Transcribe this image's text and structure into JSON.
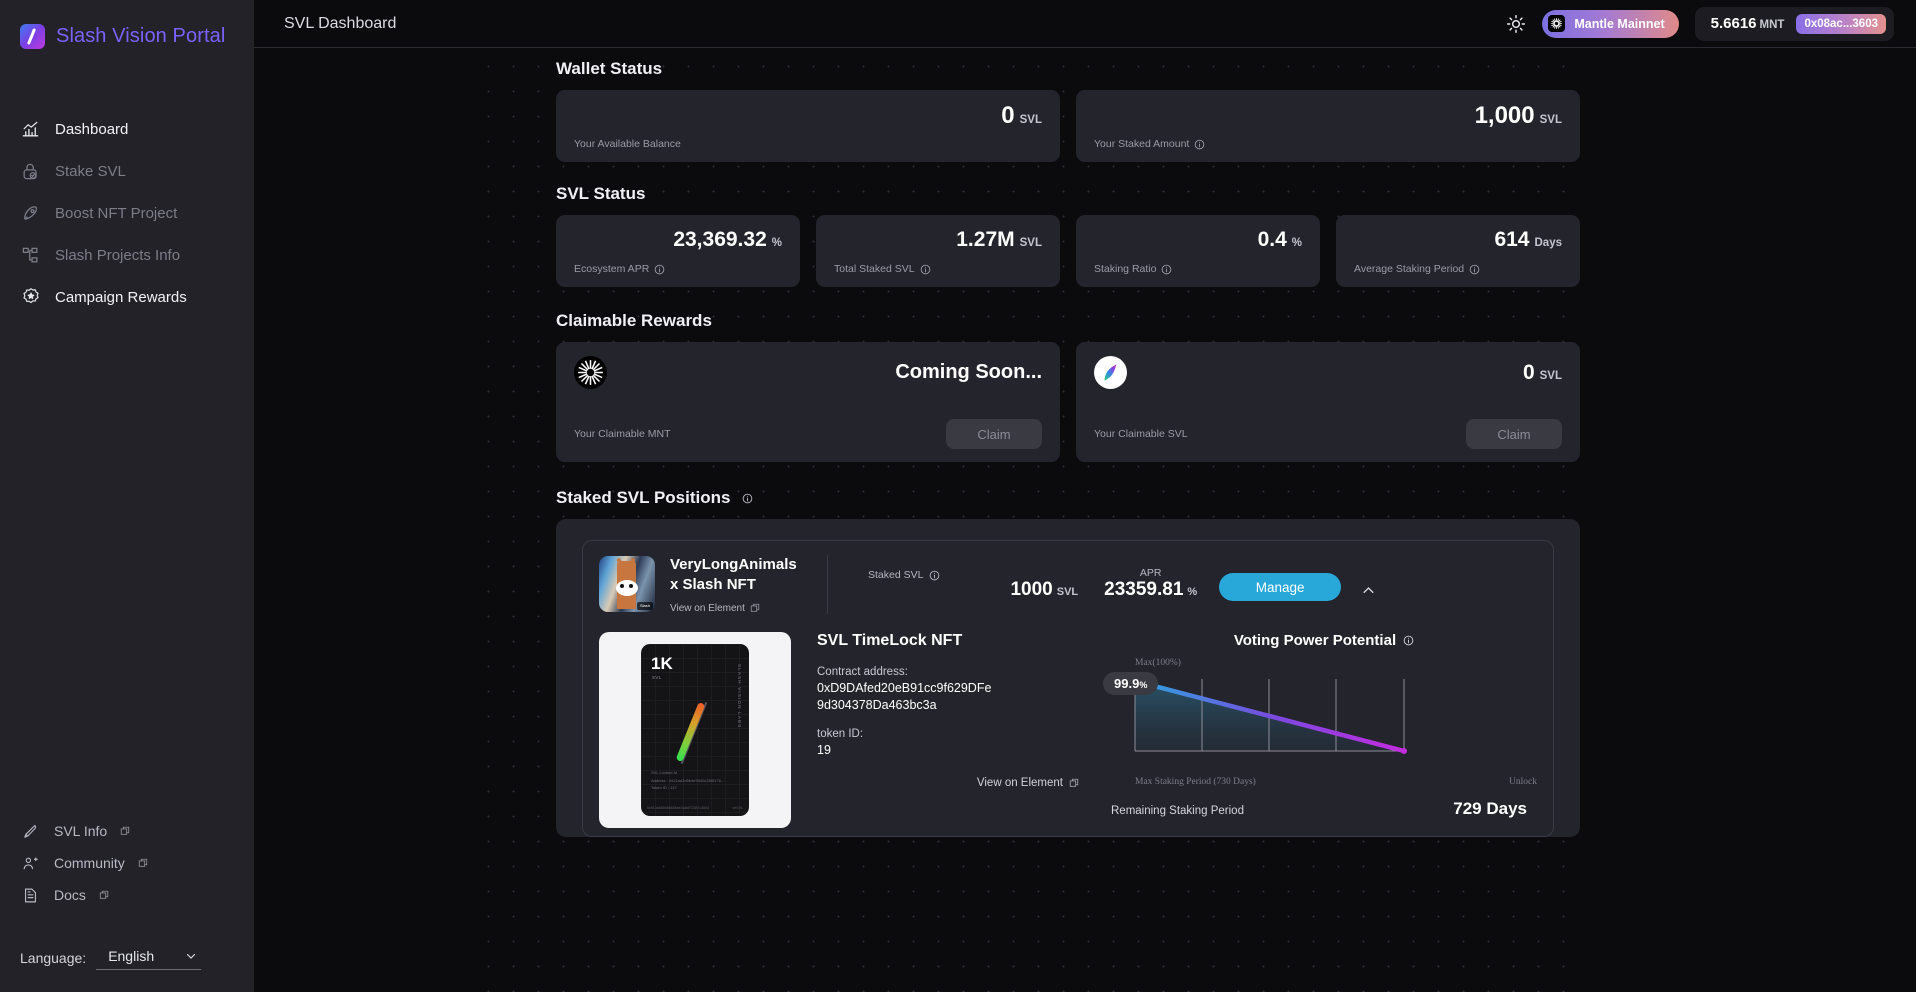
{
  "brand": {
    "name": "Slash Vision Portal"
  },
  "sidebar": {
    "items": [
      {
        "label": "Dashboard",
        "icon": "chart-icon",
        "active": true
      },
      {
        "label": "Stake SVL",
        "icon": "lock-check-icon",
        "active": false
      },
      {
        "label": "Boost NFT Project",
        "icon": "rocket-icon",
        "active": false
      },
      {
        "label": "Slash Projects Info",
        "icon": "sitemap-icon",
        "active": false
      },
      {
        "label": "Campaign Rewards",
        "icon": "badge-star-icon",
        "active": true
      }
    ],
    "footer_links": [
      {
        "label": "SVL Info",
        "icon": "pen-icon"
      },
      {
        "label": "Community",
        "icon": "users-icon"
      },
      {
        "label": "Docs",
        "icon": "document-icon"
      }
    ],
    "language": {
      "label": "Language:",
      "value": "English"
    }
  },
  "topbar": {
    "title": "SVL Dashboard",
    "theme_icon": "sun-icon",
    "network": "Mantle Mainnet",
    "wallet_balance": "5.6616",
    "wallet_unit": "MNT",
    "wallet_address": "0x08ac...3603"
  },
  "wallet_status": {
    "title": "Wallet Status",
    "cards": [
      {
        "value": "0",
        "unit": "SVL",
        "label": "Your Available Balance",
        "info": false
      },
      {
        "value": "1,000",
        "unit": "SVL",
        "label": "Your Staked Amount",
        "info": true
      }
    ]
  },
  "svl_status": {
    "title": "SVL Status",
    "cards": [
      {
        "value": "23,369.32",
        "unit": "%",
        "label": "Ecosystem APR",
        "info": true
      },
      {
        "value": "1.27M",
        "unit": "SVL",
        "label": "Total Staked SVL",
        "info": true
      },
      {
        "value": "0.4",
        "unit": "%",
        "label": "Staking Ratio",
        "info": true
      },
      {
        "value": "614",
        "unit": "Days",
        "label": "Average Staking Period",
        "info": true
      }
    ]
  },
  "claimable": {
    "title": "Claimable Rewards",
    "cards": [
      {
        "coin": "mnt-coin-icon",
        "value": "Coming Soon...",
        "unit": "",
        "label": "Your Claimable MNT",
        "button": "Claim"
      },
      {
        "coin": "svl-coin-icon",
        "value": "0",
        "unit": "SVL",
        "label": "Your Claimable SVL",
        "button": "Claim"
      }
    ]
  },
  "positions": {
    "title": "Staked SVL Positions",
    "item": {
      "nft_name": "VeryLongAnimals x Slash NFT",
      "view_link": "View on Element",
      "staked_label": "Staked SVL",
      "staked_value": "1000",
      "staked_unit": "SVL",
      "apr_label": "APR",
      "apr_value": "23359.81",
      "apr_unit": "%",
      "manage_button": "Manage",
      "detail": {
        "title": "SVL TimeLock NFT",
        "contract_label": "Contract address:",
        "contract_value": "0xD9DAfed20eB91cc9f629DFe9d304378Da463bc3a",
        "token_label": "token ID:",
        "token_value": "19",
        "view_link": "View on Element",
        "nft_card": {
          "amount": "1K",
          "unit": "SVL",
          "brand": "SLASH VISION LABS",
          "locked_label": "SVL Locked At",
          "address_line": "Address : 0x21ad3d5b4e9940c280f176...",
          "token_line": "Token ID : 147",
          "foot_left": "0x913a665e8b68bbe3a8d7C587c3603",
          "foot_right": "veSVL"
        }
      },
      "chart": {
        "title": "Voting Power Potential"
      },
      "remaining_label": "Remaining Staking Period",
      "remaining_value": "729 Days"
    }
  },
  "chart_data": {
    "type": "line",
    "title": "Voting Power Potential",
    "x": [
      0,
      730
    ],
    "series": [
      {
        "name": "Voting Power",
        "values": [
          99.9,
          0
        ]
      }
    ],
    "current_value": "99.9",
    "current_unit": "%",
    "ymax_label": "Max(100%)",
    "xlabels": [
      "Max Staking Period (730 Days)",
      "Unlock"
    ],
    "ylim": [
      0,
      100
    ],
    "xlim": [
      0,
      730
    ],
    "grid": true,
    "legend": "none",
    "line_gradient": [
      "#2aa8e0",
      "#7b49e0",
      "#c42ce0"
    ],
    "area_fill": "#1e3b4a"
  },
  "colors": {
    "accent": "#7b61ff",
    "button": "#27a8d9",
    "card_bg": "#24242c",
    "page_bg": "#0b0b0d"
  }
}
